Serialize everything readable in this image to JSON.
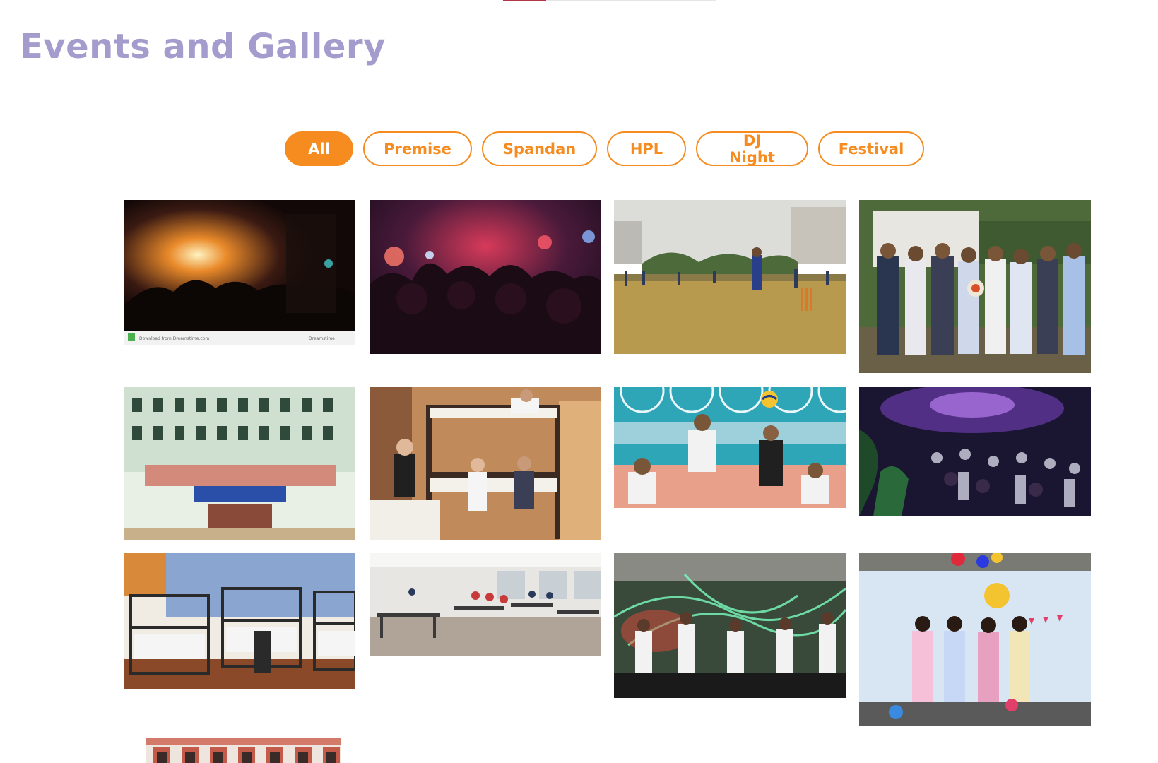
{
  "header": {
    "title": "Events and Gallery"
  },
  "filters": [
    {
      "label": "All",
      "active": true
    },
    {
      "label": "Premise",
      "active": false
    },
    {
      "label": "Spandan",
      "active": false
    },
    {
      "label": "HPL",
      "active": false
    },
    {
      "label": "DJ Night",
      "active": false
    },
    {
      "label": "Festival",
      "active": false
    }
  ],
  "colors": {
    "title": "#a49ccd",
    "accent": "#f68b1f",
    "indicator_active": "#b4344a",
    "indicator_track": "#e6e6e6"
  },
  "gallery": {
    "item_count": 13,
    "stock_footer_left": "Download from Dreamstime.com",
    "stock_footer_right": "Dreamstime"
  }
}
